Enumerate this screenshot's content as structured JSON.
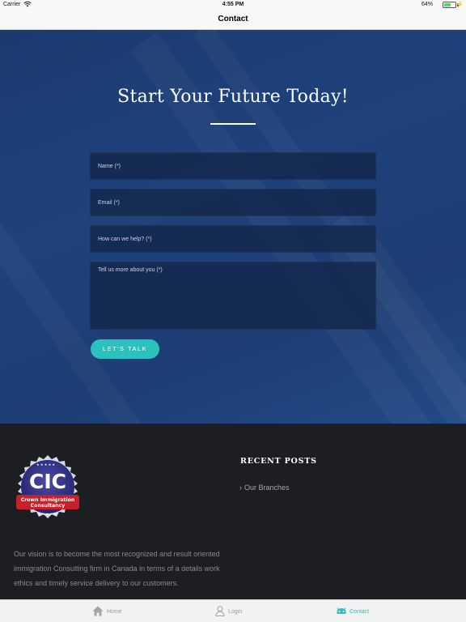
{
  "status_bar": {
    "carrier": "Carrier",
    "time": "4:55 PM",
    "battery_percent": "64%",
    "battery_level": 0.64
  },
  "nav": {
    "title": "Contact"
  },
  "hero": {
    "headline": "Start Your Future Today!",
    "form": {
      "name_placeholder": "Name (*)",
      "email_placeholder": "Email (*)",
      "help_placeholder": "How can we help? (*)",
      "about_placeholder": "Tell us more about you (*)",
      "submit_label": "LET'S TALK"
    }
  },
  "footer": {
    "logo": {
      "text": "CIC",
      "tagline_line1": "Crown Immigration",
      "tagline_line2": "Consultancy"
    },
    "recent_posts_title": "RECENT POSTS",
    "recent_posts": [
      {
        "label": "Our Branches"
      }
    ],
    "vision": "Our vision is to become the most recognized and result oriented immigration Consulting firm in Canada in terms of a details work ethics and timely service delivery to our customers."
  },
  "tabs": [
    {
      "label": "Home",
      "icon": "home-icon",
      "active": false
    },
    {
      "label": "Login",
      "icon": "user-icon",
      "active": false
    },
    {
      "label": "Contact",
      "icon": "contact-icon",
      "active": true
    }
  ],
  "colors": {
    "accent": "#2bc1bd",
    "hero_bg": "#1f427c",
    "footer_bg": "#1d1e22"
  }
}
